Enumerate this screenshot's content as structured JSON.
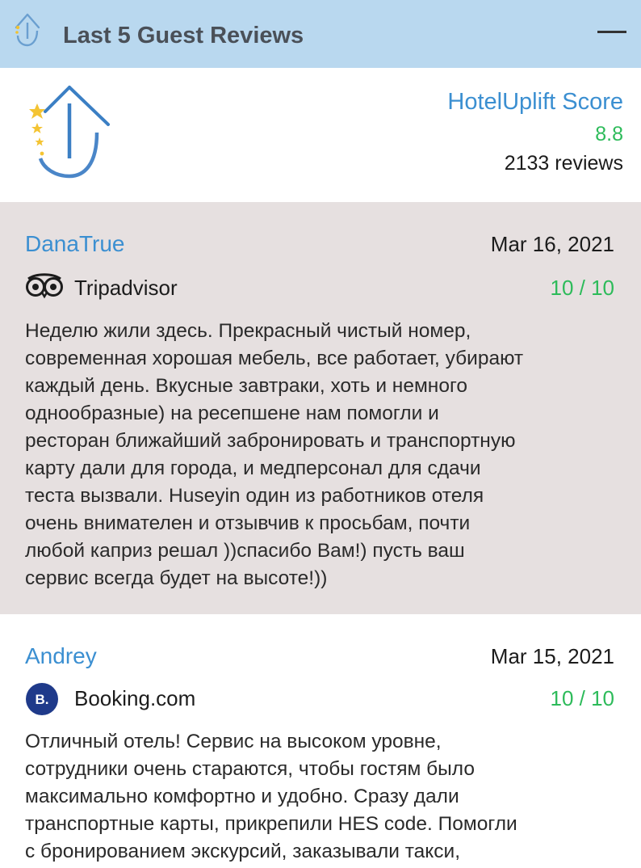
{
  "header": {
    "title": "Last 5 Guest Reviews",
    "collapse_icon": "minus-icon"
  },
  "score": {
    "title": "HotelUplift Score",
    "value": "8.8",
    "reviews": "2133 reviews",
    "colors": {
      "title": "#3b8fd1",
      "value": "#2dbb5a"
    }
  },
  "reviews": [
    {
      "name": "DanaTrue",
      "date": "Mar 16, 2021",
      "source": "Tripadvisor",
      "source_icon": "tripadvisor-owl-icon",
      "rating": "10 / 10",
      "text": [
        "Неделю жили здесь. Прекрасный чистый номер,",
        "современная хорошая мебель, все работает, убирают",
        "каждый день. Вкусные завтраки, хоть и немного",
        "однообразные) на ресепшене нам помогли и",
        "ресторан ближайший забронировать и транспортную",
        "карту дали для города, и медперсонал для сдачи",
        "теста вызвали. Huseyin один из работников отеля",
        "очень внимателен и отзывчив к просьбам, почти",
        "любой каприз решал ))спасибо Вам!) пусть ваш",
        "сервис всегда будет на высоте!))"
      ]
    },
    {
      "name": "Andrey",
      "date": "Mar 15, 2021",
      "source": "Booking.com",
      "source_icon": "booking-b-icon",
      "source_icon_letter": "B.",
      "rating": "10 / 10",
      "text": [
        "Отличный отель! Сервис на высоком уровне,",
        "сотрудники очень стараются, чтобы гостям было",
        "максимально комфортно и удобно. Сразу дали",
        "транспортные карты, прикрепили HES code. Помогли",
        "с бронированием экскурсий, заказывали такси,"
      ]
    }
  ]
}
